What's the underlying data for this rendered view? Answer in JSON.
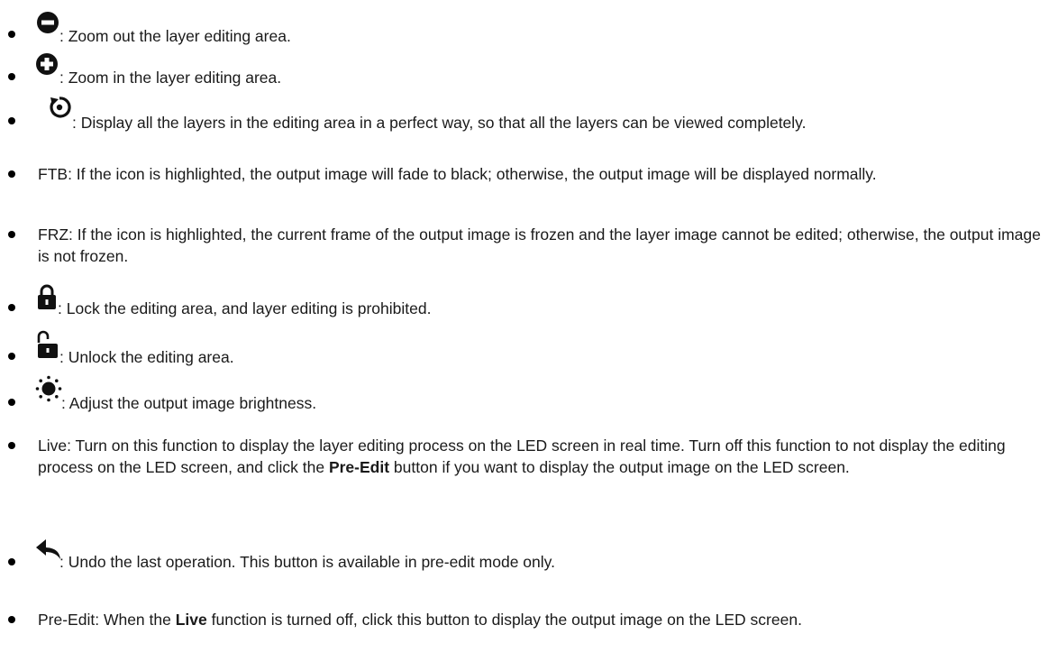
{
  "items": [
    {
      "icon": "zoom-out-icon",
      "text": ": Zoom out the layer editing area."
    },
    {
      "icon": "zoom-in-icon",
      "text": ": Zoom in the layer editing area."
    },
    {
      "icon": "fit-view-icon",
      "text": ": Display all the layers in the editing area in a perfect way, so that all the layers can be viewed completely."
    },
    {
      "label": "FTB",
      "text": ": If the icon is highlighted, the output image will fade to black; otherwise, the output image will be displayed normally."
    },
    {
      "label": "FRZ",
      "text": ": If the icon is highlighted, the current frame of the output image is frozen and the layer image cannot be edited; otherwise, the output image is not frozen."
    },
    {
      "icon": "lock-icon",
      "text": ": Lock the editing area, and layer editing is prohibited."
    },
    {
      "icon": "unlock-icon",
      "text": ": Unlock the editing area."
    },
    {
      "icon": "brightness-icon",
      "text": ": Adjust the output image brightness."
    },
    {
      "label": "Live",
      "text_a": ": Turn on this function to display the layer editing process on the LED screen in real time. Turn off this function to not display the editing process on the LED screen, and click the ",
      "bold": "Pre-Edit",
      "text_b": " button if you want to display the output image on the LED screen."
    },
    {
      "icon": "undo-icon",
      "text": ": Undo the last operation. This button is available in pre-edit mode only."
    },
    {
      "label": "Pre-Edit",
      "text_a": ": When the ",
      "bold": "Live",
      "text_b": " function is turned off, click this button to display the output image on the LED screen."
    }
  ]
}
